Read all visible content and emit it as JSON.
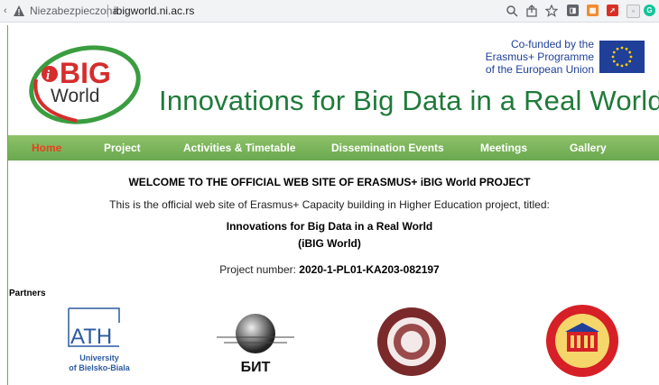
{
  "browser": {
    "security_label": "Niezabezpieczona",
    "url": "ibigworld.ni.ac.rs",
    "left_edge_char": "‹"
  },
  "header": {
    "logo_text_top": "BIG",
    "logo_text_i": "i",
    "logo_text_bottom": "World",
    "cofund_line1": "Co-funded by the",
    "cofund_line2": "Erasmus+ Programme",
    "cofund_line3": "of the European Union",
    "site_title": "Innovations for Big Data in a Real World"
  },
  "nav": {
    "items": [
      {
        "label": "Home",
        "active": true
      },
      {
        "label": "Project"
      },
      {
        "label": "Activities & Timetable"
      },
      {
        "label": "Dissemination Events"
      },
      {
        "label": "Meetings"
      },
      {
        "label": "Gallery"
      }
    ]
  },
  "content": {
    "welcome": "WELCOME TO THE OFFICIAL WEB SITE OF ERASMUS+ iBIG World PROJECT",
    "intro": "This is the official web site of Erasmus+ Capacity building in Higher Education project, titled:",
    "project_title": "Innovations for Big Data in a Real World",
    "project_abbr": "(iBIG World)",
    "project_number_label": "Project number: ",
    "project_number": "2020-1-PL01-KA203-082197",
    "partners_label": "Partners"
  },
  "partners": {
    "ath_line1": "University",
    "ath_line2": "of Bielsko-Biala",
    "ath_mark": "ATH",
    "bit_text": "БИТ"
  },
  "colors": {
    "nav_green": "#6aa84f",
    "title_green": "#1f7a3a",
    "active_orange": "#e8401f",
    "eu_blue": "#1f3f99"
  }
}
